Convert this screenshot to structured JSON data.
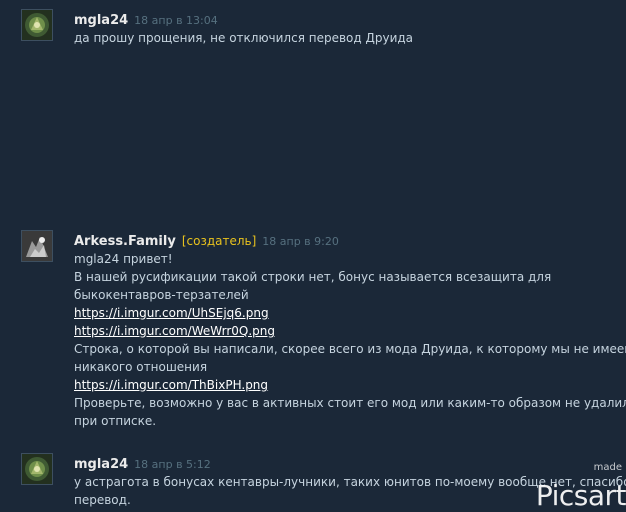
{
  "comments": [
    {
      "author": "mgla24",
      "timestamp": "18 апр в 13:04",
      "lines": [
        "да прошу прощения, не отключился перевод Друида"
      ]
    },
    {
      "author": "Arkess.Family",
      "badge": "[создатель]",
      "timestamp": "18 апр в 9:20",
      "lines": [
        "mgla24 привет!",
        "В нашей русификации такой строки нет, бонус называется всезащита для",
        "быкокентавров-терзателей"
      ],
      "links": [
        "https://i.imgur.com/UhSEjq6.png",
        "https://i.imgur.com/WeWrr0Q.png"
      ],
      "lines2": [
        "Строка, о которой вы написали, скорее всего из мода Друида, к которому мы не имеем",
        "никакого отношения"
      ],
      "link3": "https://i.imgur.com/ThBixPH.png",
      "lines3": [
        "Проверьте, возможно у вас в активных стоит его мод или каким-то образом не удалился",
        "при отписке."
      ]
    },
    {
      "author": "mgla24",
      "timestamp": "18 апр в 5:12",
      "lines": [
        "у астрагота в бонусах кентавры-лучники, таких юнитов по-моему вообще нет, спасибо за",
        "перевод."
      ]
    }
  ],
  "watermark": {
    "made": "made",
    "brand": "Picsart"
  },
  "colors": {
    "background": "#1b2838",
    "author": "#ebebeb",
    "creator_badge": "#e8c21e",
    "timestamp": "#56707f",
    "text": "#c6d4df",
    "link": "#ffffff"
  }
}
